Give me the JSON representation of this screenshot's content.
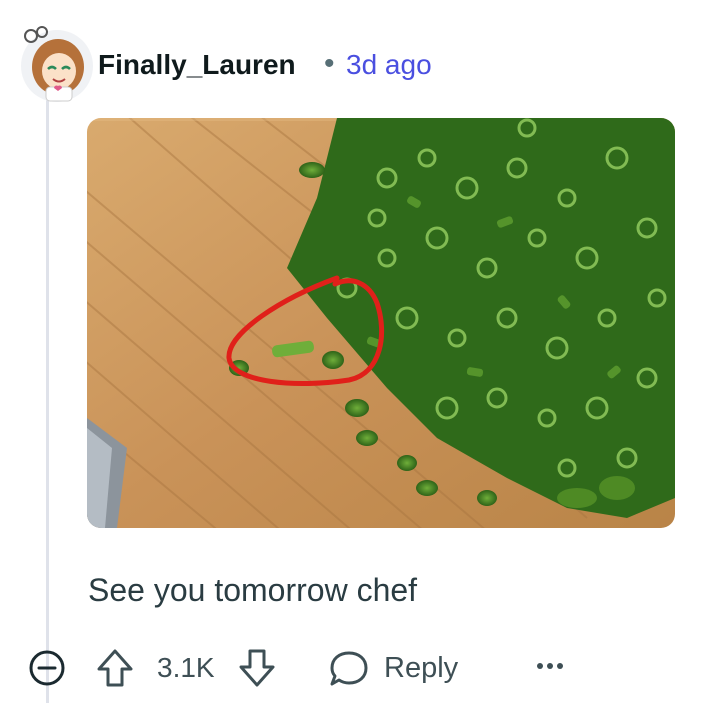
{
  "comment": {
    "author": "Finally_Lauren",
    "separator": "•",
    "timestamp": "3d ago",
    "body": "See you tomorrow chef"
  },
  "actions": {
    "score": "3.1K",
    "reply_label": "Reply",
    "more_label": "···"
  },
  "icons": {
    "avatar": "avatar",
    "collapse": "collapse-icon",
    "upvote": "upvote-icon",
    "downvote": "downvote-icon",
    "reply": "comment-bubble-icon",
    "more": "ellipsis-icon"
  },
  "colors": {
    "timestamp": "#4a4fe0",
    "text": "#2a3c42",
    "icon": "#3e4f55",
    "chives": "#3f7d1f",
    "board": "#c9955a",
    "circle": "#e0201a"
  }
}
